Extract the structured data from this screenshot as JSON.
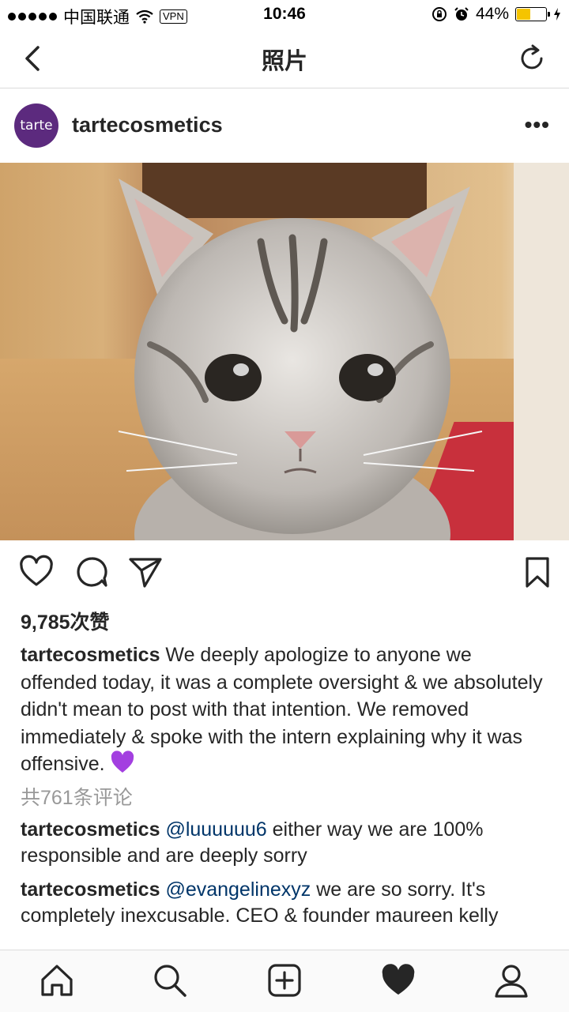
{
  "status_bar": {
    "carrier": "中国联通",
    "vpn": "VPN",
    "time": "10:46",
    "battery": "44%",
    "battery_level": 0.44
  },
  "nav": {
    "title": "照片"
  },
  "post": {
    "avatar_text": "tarte",
    "username": "tartecosmetics",
    "likes": "9,785次赞",
    "caption_user": "tartecosmetics",
    "caption_text": " We deeply apologize to anyone we offended today, it was a complete oversight & we absolutely didn't mean to post with that intention. We removed immediately & spoke with the intern explaining why it was offensive. ",
    "view_comments": "共761条评论",
    "comments": [
      {
        "user": "tartecosmetics",
        "mention": "@luuuuuu6",
        "text": " either way we are 100% responsible and are deeply sorry"
      },
      {
        "user": "tartecosmetics",
        "mention": "@evangelinexyz",
        "text": " we are so sorry. It's completely inexcusable. CEO & founder maureen kelly"
      }
    ]
  },
  "colors": {
    "avatar_bg": "#5c2a7e",
    "battery_fill": "#f5c400",
    "mention": "#003569",
    "muted_text": "#999999",
    "purple_heart": "#a33fe0"
  },
  "icons": {
    "back": "chevron-left-icon",
    "refresh": "refresh-icon",
    "more": "more-dots-icon",
    "like": "heart-outline-icon",
    "comment": "comment-bubble-icon",
    "share": "paper-plane-icon",
    "save": "bookmark-icon",
    "home": "home-icon",
    "search": "search-icon",
    "add": "add-post-icon",
    "activity": "heart-filled-icon",
    "profile": "profile-icon"
  }
}
